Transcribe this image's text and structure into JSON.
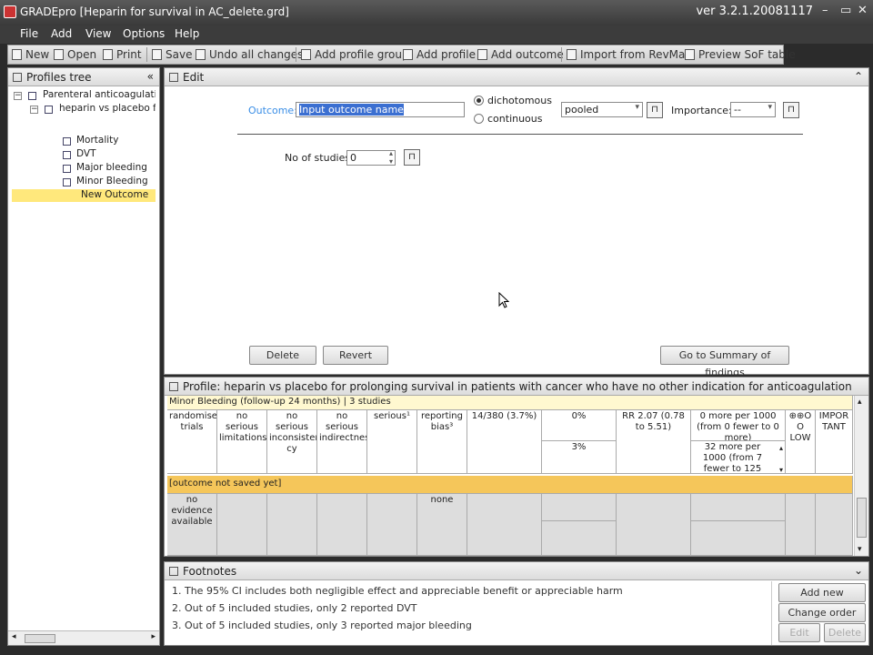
{
  "window": {
    "title": "GRADEpro [Heparin for survival in AC_delete.grd]",
    "version": "ver 3.2.1.20081117"
  },
  "menu": [
    "File",
    "Add",
    "View",
    "Options",
    "Help"
  ],
  "toolbar": {
    "new": "New",
    "open": "Open",
    "print": "Print",
    "save": "Save",
    "undo": "Undo all changes",
    "add_group": "Add profile group",
    "add_profile": "Add profile",
    "add_outcome": "Add outcome",
    "import": "Import from RevMan",
    "preview": "Preview SoF table"
  },
  "profiles_tree": {
    "title": "Profiles tree",
    "group": "Parenteral anticoagulation fo",
    "profile": "heparin vs placebo for p",
    "outcomes": [
      "Mortality",
      "DVT",
      "Major bleeding",
      "Minor Bleeding"
    ],
    "selected": "New Outcome"
  },
  "edit": {
    "title": "Edit",
    "outcome_label": "Outcome:",
    "outcome_value": "Input outcome name",
    "dichotomous": "dichotomous",
    "continuous": "continuous",
    "pooled": "pooled",
    "importance_label": "Importance:",
    "importance_value": "--",
    "studies_label": "No of studies",
    "studies_value": "0",
    "delete": "Delete",
    "revert": "Revert",
    "goto_sof": "Go to Summary of findings"
  },
  "profile": {
    "title": "Profile: heparin vs placebo for prolonging survival in patients with cancer who have no other indication for anticoagulation",
    "section1": "Minor Bleeding (follow-up 24 months) | 3 studies",
    "row1": {
      "design": "randomised trials",
      "limitations": "no serious limitations",
      "inconsistency": "no serious inconsisten cy",
      "indirectness": "no serious indirectness",
      "imprecision": "serious¹",
      "other": "reporting bias³",
      "events": "14/380  (3.7%)",
      "control1": "0%",
      "control2": "3%",
      "relative": "RR 2.07 (0.78 to 5.51)",
      "absolute1": "0 more per 1000 (from 0 fewer to 0 more)",
      "absolute2": "32 more per 1000 (from 7 fewer to 125",
      "quality": "⊕⊕O O LOW",
      "importance": "IMPOR TANT"
    },
    "section2": "[outcome not saved yet]",
    "row2": {
      "design": "no evidence available",
      "other": "none"
    }
  },
  "footnotes": {
    "title": "Footnotes",
    "items": [
      "1. The 95% CI includes both negligible effect and appreciable benefit or appreciable harm",
      "2. Out of 5 included studies, only 2 reported DVT",
      "3. Out of 5 included studies, only 3 reported major bleeding"
    ],
    "add_new": "Add new",
    "change_order": "Change order",
    "edit": "Edit",
    "delete": "Delete"
  }
}
